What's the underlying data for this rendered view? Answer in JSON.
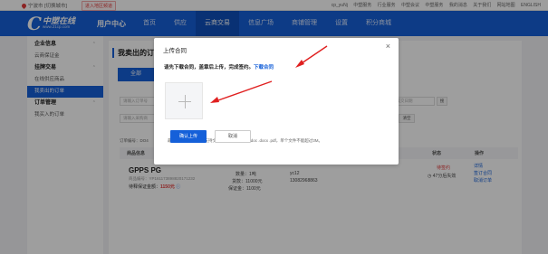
{
  "topbar": {
    "location": "宁波市 [切换城市]",
    "enter_label": "进入地区频道",
    "links": [
      "cp_yuNj",
      "中塑服务",
      "行业服务",
      "中塑会议",
      "中塑服务",
      "我的消息",
      "关于我们",
      "网站地图",
      "ENGLISH"
    ]
  },
  "logo": {
    "brand": "中塑在线",
    "url": "www.21cp.com"
  },
  "nav": {
    "user_center": "用户中心",
    "items": [
      {
        "label": "首页"
      },
      {
        "label": "供应"
      },
      {
        "label": "云商交易"
      },
      {
        "label": "信息广场"
      },
      {
        "label": "商铺管理"
      },
      {
        "label": "设置"
      },
      {
        "label": "积分商城"
      }
    ]
  },
  "sidebar": {
    "groups": [
      {
        "label": "企业信息",
        "items": [
          "云商保证金"
        ]
      },
      {
        "label": "挂牌交易",
        "items": [
          "在线供应商品",
          "我卖出的订单"
        ]
      },
      {
        "label": "订单管理",
        "items": [
          "我买入的订单"
        ]
      }
    ]
  },
  "main": {
    "title": "我卖出的订单",
    "tab_all": "全部",
    "filter_order_placeholder": "请输入订单号",
    "filter_product_placeholder": "请输入采购商",
    "filter_date_placeholder": "请选择成交日期",
    "search_btn": "搜",
    "clear_btn": "清空",
    "order_no": "订单编号：DO4",
    "columns": {
      "product": "商品信息",
      "status": "状态",
      "action": "操作"
    },
    "product_name": "GPPS PG",
    "product_sub": "商品编号：YP161173898820171232",
    "deposit_label": "待释保证金额：",
    "deposit_value": "1150元",
    "qty": "数量：1吨",
    "payment": "货款：11000元",
    "margin": "保证金：1100元",
    "buyer": "yc12",
    "phone": "13082968863",
    "status_pending": "待签约",
    "status_timer": "47分后失效",
    "actions": [
      "详情",
      "签订合同",
      "取消订单"
    ]
  },
  "modal": {
    "title": "上传合同",
    "close_glyph": "×",
    "instruction": "请先下载合同，盖章后上传，完成签约。",
    "download_link": "下载合同",
    "hint": "最多上传五个文件，支持文件格式：.jpg .png .doc .docx .pdf，单个文件不能超过3M。",
    "confirm_label": "确认上传",
    "cancel_label": "取消"
  },
  "colors": {
    "brand_blue": "#1560d9",
    "annotation_red": "#e02020"
  }
}
